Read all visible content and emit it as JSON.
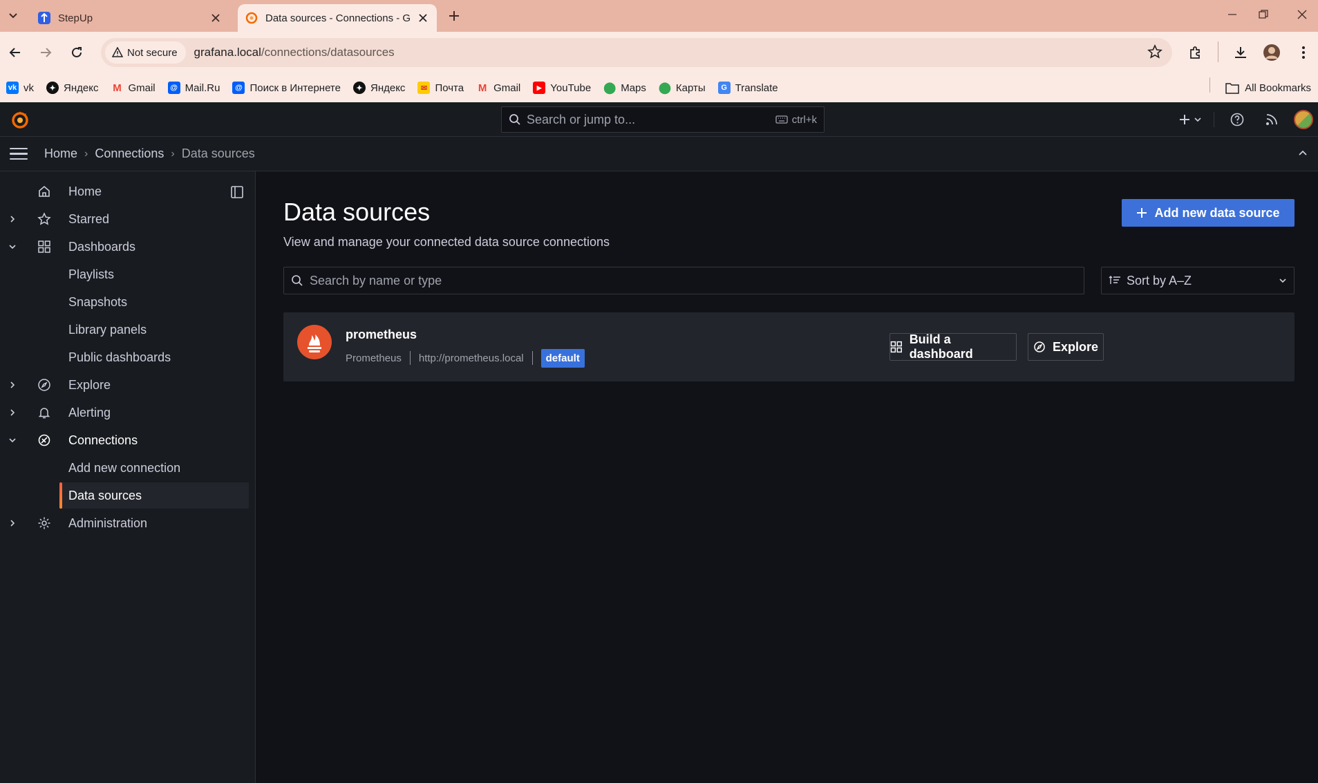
{
  "browser": {
    "tabs": [
      {
        "title": "StepUp",
        "active": false
      },
      {
        "title": "Data sources - Connections - G",
        "active": true
      }
    ],
    "security_label": "Not secure",
    "url_host": "grafana.local",
    "url_path": "/connections/datasources",
    "bookmarks": [
      {
        "label": "vk",
        "icon": "vk-icon"
      },
      {
        "label": "Яндекс",
        "icon": "yandex-icon"
      },
      {
        "label": "Gmail",
        "icon": "gmail-icon"
      },
      {
        "label": "Mail.Ru",
        "icon": "mailru-icon"
      },
      {
        "label": "Поиск в Интернете",
        "icon": "mailru-search-icon"
      },
      {
        "label": "Яндекс",
        "icon": "yandex-icon"
      },
      {
        "label": "Почта",
        "icon": "yandex-mail-icon"
      },
      {
        "label": "Gmail",
        "icon": "gmail-icon"
      },
      {
        "label": "YouTube",
        "icon": "youtube-icon"
      },
      {
        "label": "Maps",
        "icon": "maps-icon"
      },
      {
        "label": "Карты",
        "icon": "maps-icon"
      },
      {
        "label": "Translate",
        "icon": "translate-icon"
      }
    ],
    "all_bookmarks": "All Bookmarks"
  },
  "grafana": {
    "search_placeholder": "Search or jump to...",
    "search_shortcut": "ctrl+k",
    "breadcrumbs": [
      "Home",
      "Connections",
      "Data sources"
    ],
    "nav": {
      "home": "Home",
      "starred": "Starred",
      "dashboards": "Dashboards",
      "playlists": "Playlists",
      "snapshots": "Snapshots",
      "library_panels": "Library panels",
      "public_dashboards": "Public dashboards",
      "explore": "Explore",
      "alerting": "Alerting",
      "connections": "Connections",
      "add_new_connection": "Add new connection",
      "data_sources": "Data sources",
      "administration": "Administration"
    },
    "page": {
      "title": "Data sources",
      "subtitle": "View and manage your connected data source connections",
      "add_button": "Add new data source",
      "search_placeholder": "Search by name or type",
      "sort_label": "Sort by A–Z"
    },
    "datasources": [
      {
        "name": "prometheus",
        "type": "Prometheus",
        "url": "http://prometheus.local",
        "badge": "default",
        "build_button": "Build a dashboard",
        "explore_button": "Explore"
      }
    ],
    "colors": {
      "accent_orange": "#f55f3e",
      "primary_blue": "#3d71d9",
      "badge_blue": "#3871dc"
    }
  }
}
